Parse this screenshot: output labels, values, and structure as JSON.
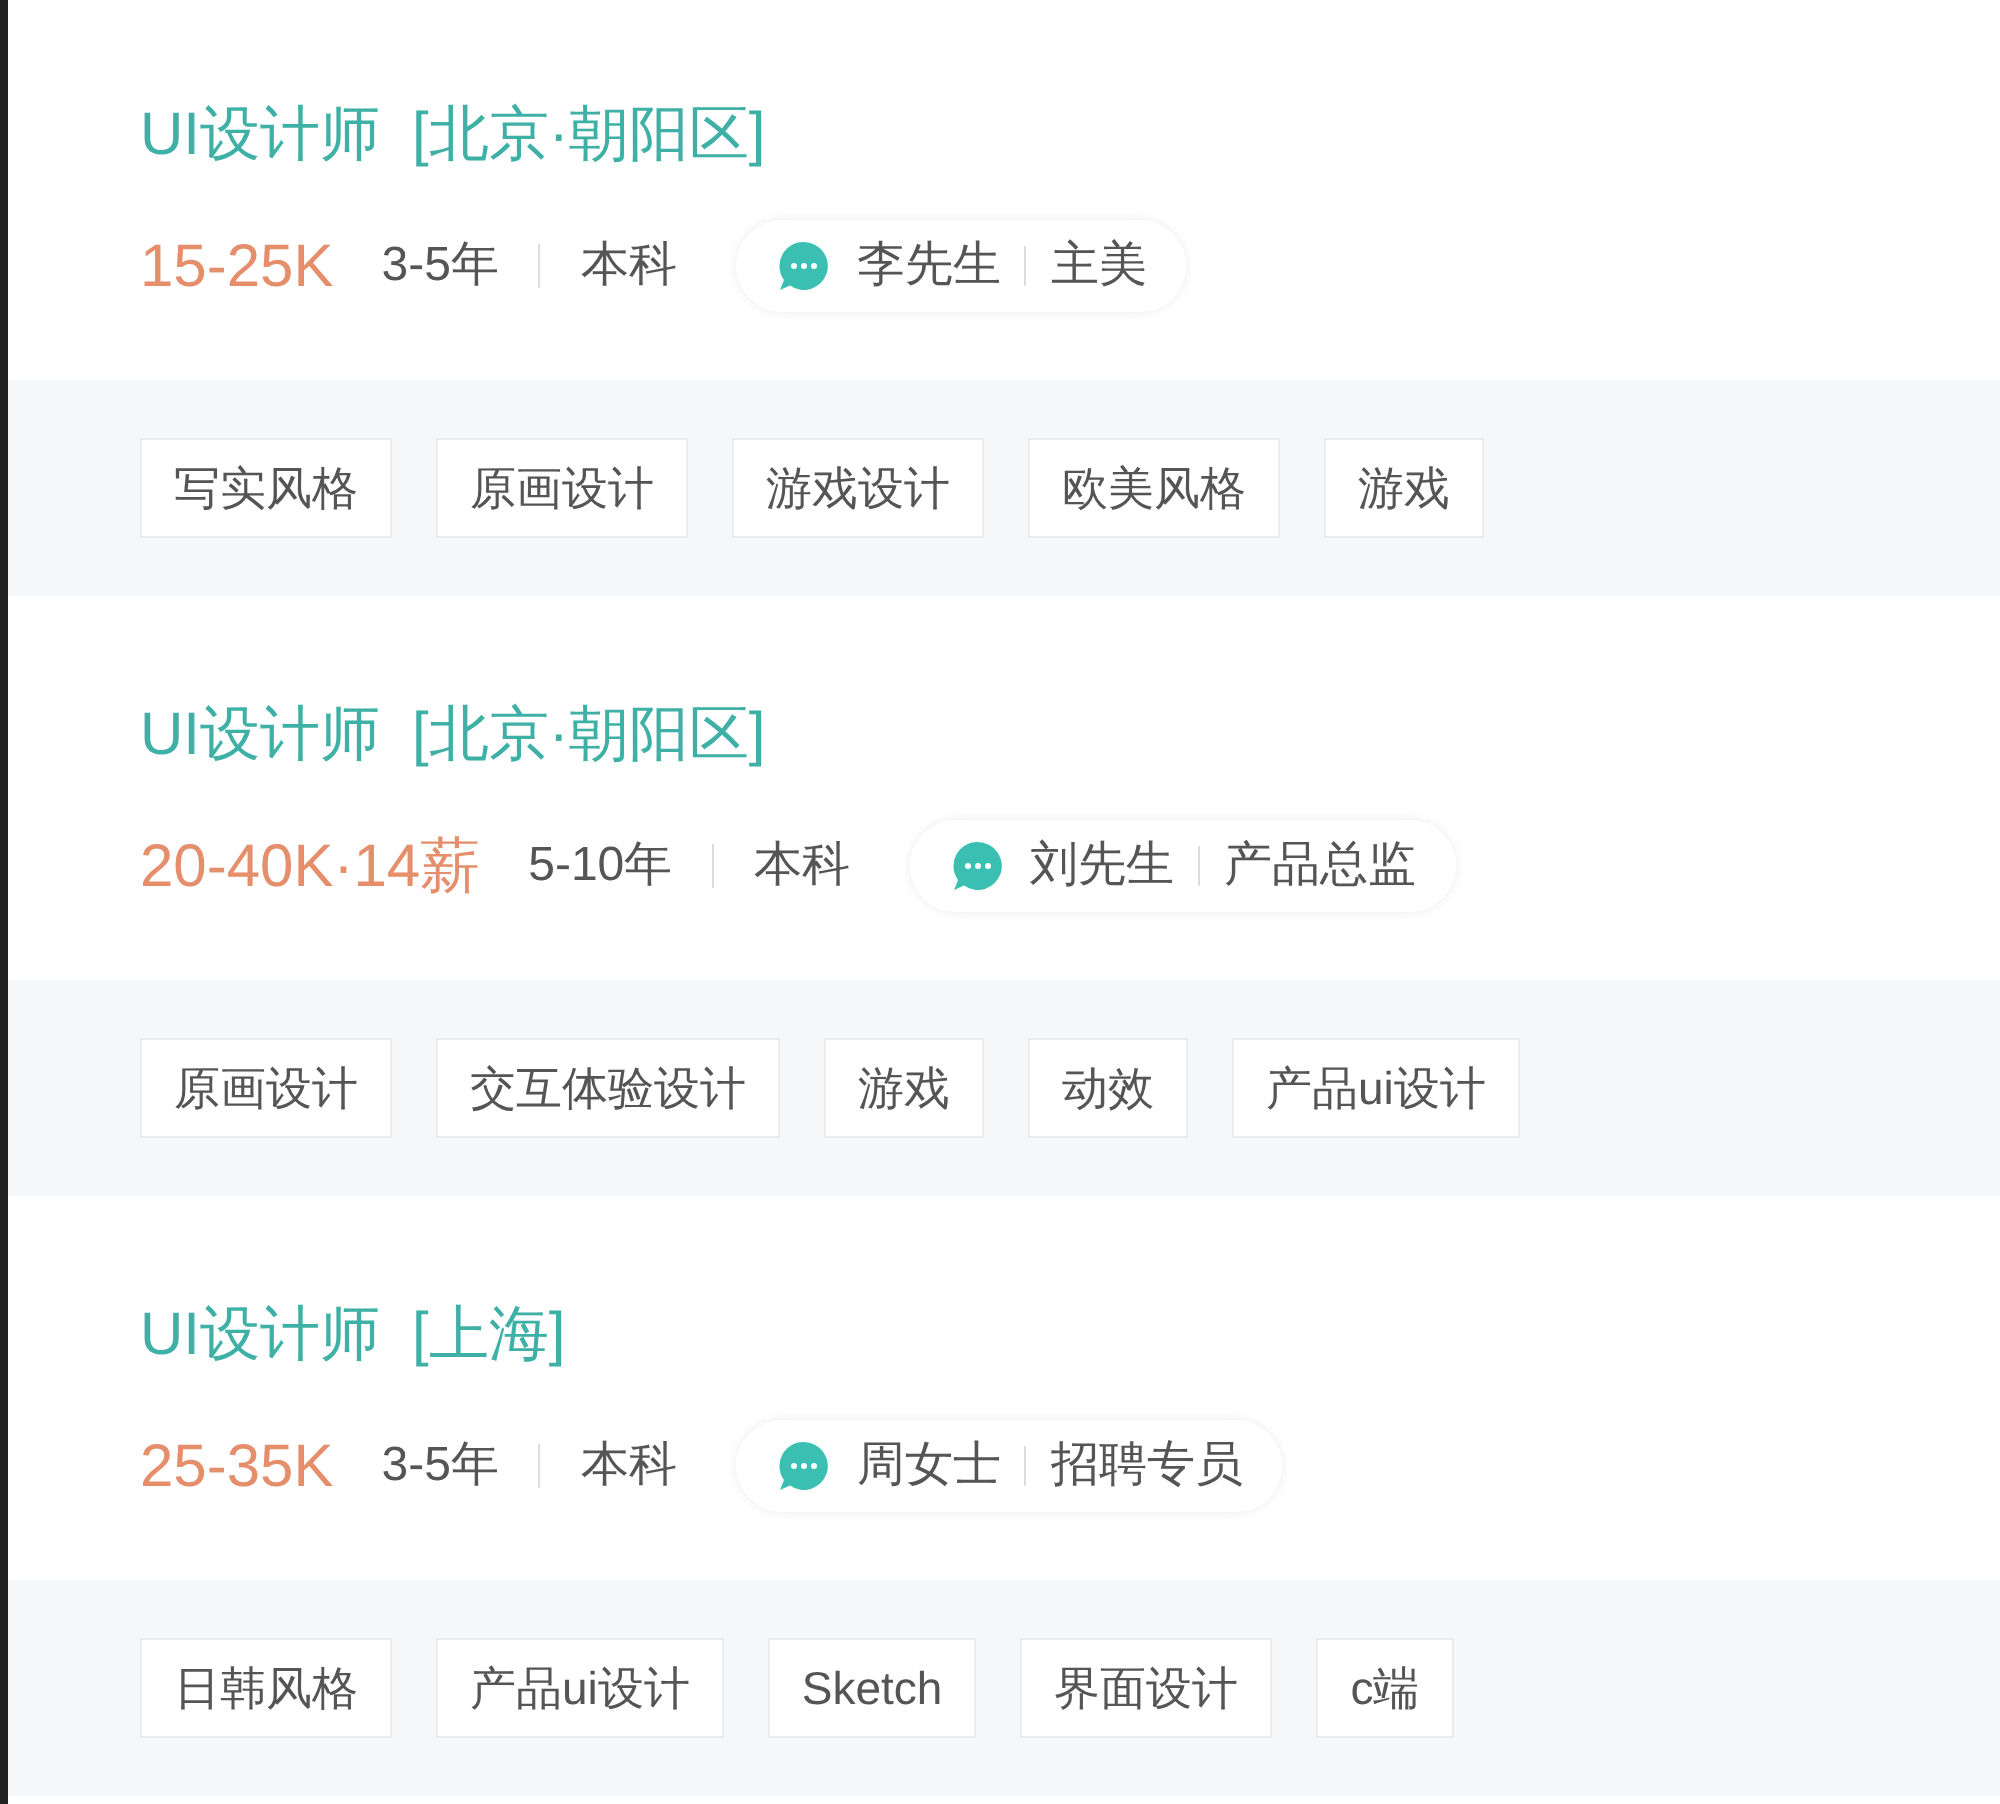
{
  "jobs": [
    {
      "title": "UI设计师",
      "location": "[北京·朝阳区]",
      "salary": "15-25K",
      "experience": "3-5年",
      "education": "本科",
      "contact": {
        "name": "李先生",
        "role": "主美"
      },
      "tags": [
        "写实风格",
        "原画设计",
        "游戏设计",
        "欧美风格",
        "游戏"
      ]
    },
    {
      "title": "UI设计师",
      "location": "[北京·朝阳区]",
      "salary": "20-40K·14薪",
      "experience": "5-10年",
      "education": "本科",
      "contact": {
        "name": "刘先生",
        "role": "产品总监"
      },
      "tags": [
        "原画设计",
        "交互体验设计",
        "游戏",
        "动效",
        "产品ui设计"
      ]
    },
    {
      "title": "UI设计师",
      "location": "[上海]",
      "salary": "25-35K",
      "experience": "3-5年",
      "education": "本科",
      "contact": {
        "name": "周女士",
        "role": "招聘专员"
      },
      "tags": [
        "日韩风格",
        "产品ui设计",
        "Sketch",
        "界面设计",
        "c端"
      ]
    }
  ]
}
